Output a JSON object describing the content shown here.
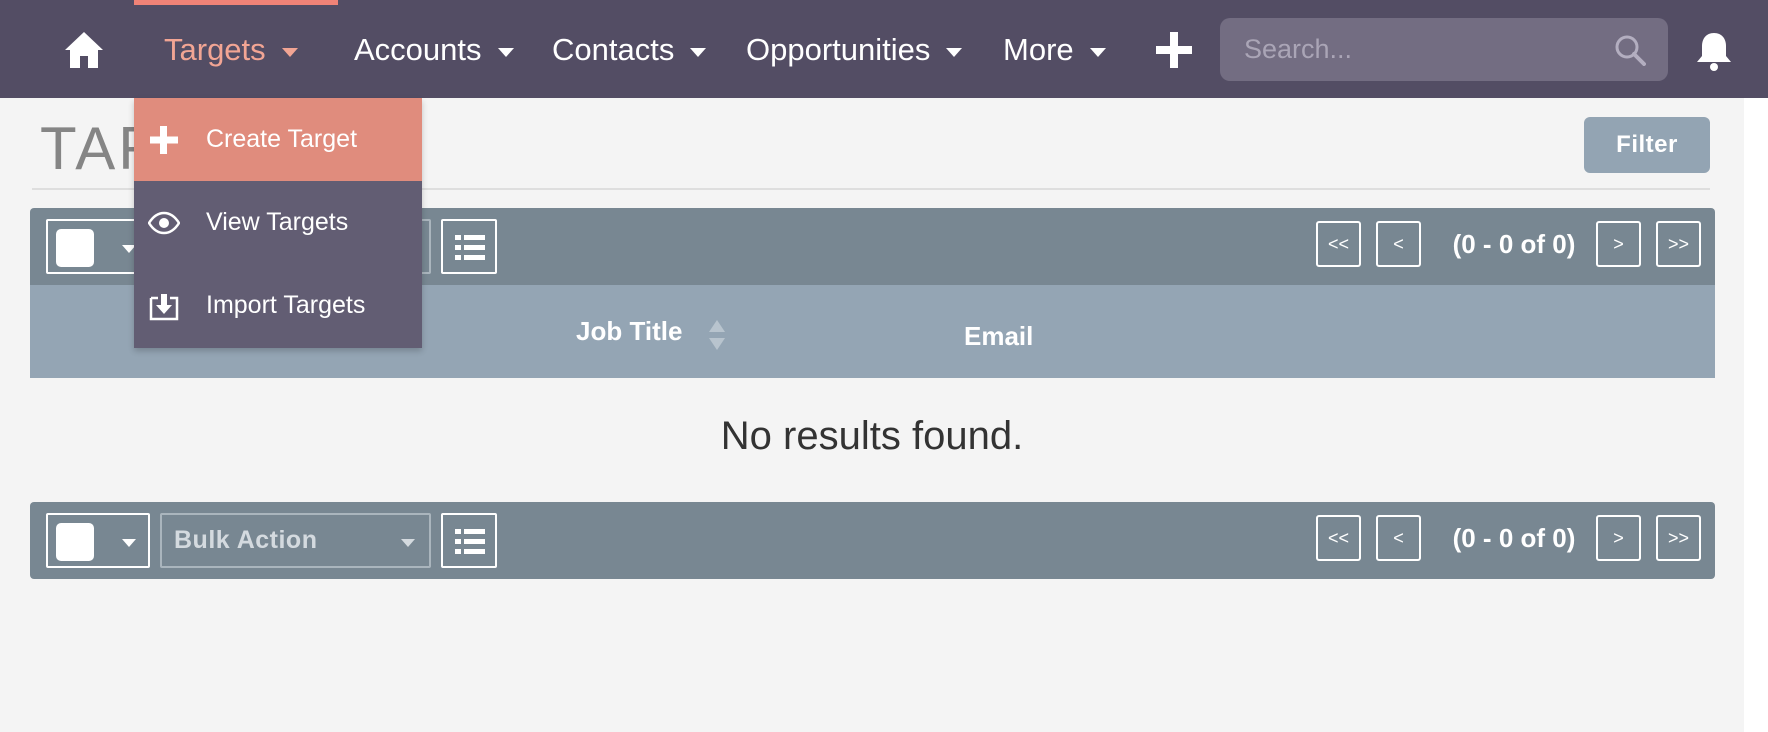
{
  "nav": {
    "items": [
      {
        "label": "Targets",
        "active": true
      },
      {
        "label": "Accounts"
      },
      {
        "label": "Contacts"
      },
      {
        "label": "Opportunities"
      },
      {
        "label": "More"
      }
    ],
    "search_placeholder": "Search..."
  },
  "dropdown": {
    "items": [
      {
        "label": "Create Target",
        "icon": "plus-icon",
        "highlighted": true
      },
      {
        "label": "View Targets",
        "icon": "eye-icon"
      },
      {
        "label": "Import Targets",
        "icon": "import-icon"
      }
    ]
  },
  "page": {
    "title": "TARGETS",
    "filter_label": "Filter"
  },
  "toolbar": {
    "bulk_action_label": "Bulk Action",
    "first_label": "<<",
    "prev_label": "<",
    "next_label": ">",
    "last_label": ">>",
    "count_text": "(0 - 0 of 0)"
  },
  "table": {
    "columns": [
      "Job Title",
      "Email"
    ],
    "empty_message": "No results found."
  },
  "colors": {
    "nav_bg": "#534d64",
    "accent": "#f08377",
    "dropdown_bg": "#625d73",
    "toolbar_bg": "#788792",
    "table_header_bg": "#94a5b4"
  }
}
